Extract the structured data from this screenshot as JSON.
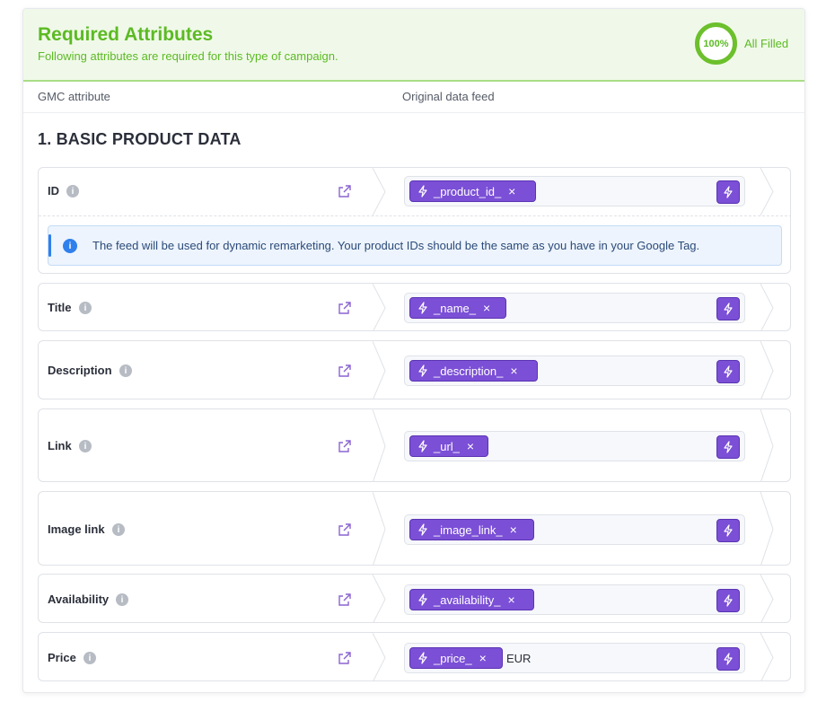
{
  "header": {
    "title": "Required Attributes",
    "subtitle": "Following attributes are required for this type of campaign.",
    "progress_value": "100%",
    "progress_label": "All Filled",
    "accent_color": "#5cba24"
  },
  "columns": {
    "gmc": "GMC attribute",
    "feed": "Original data feed"
  },
  "section": {
    "title": "1. BASIC PRODUCT DATA"
  },
  "notice": {
    "icon": "info-icon",
    "text": "The feed will be used for dynamic remarketing. Your product IDs should be the same as you have in your Google Tag."
  },
  "attributes": [
    {
      "name": "ID",
      "value": "_product_id_",
      "suffix": ""
    },
    {
      "name": "Title",
      "value": "_name_",
      "suffix": ""
    },
    {
      "name": "Description",
      "value": "_description_",
      "suffix": ""
    },
    {
      "name": "Link",
      "value": "_url_",
      "suffix": ""
    },
    {
      "name": "Image link",
      "value": "_image_link_",
      "suffix": ""
    },
    {
      "name": "Availability",
      "value": "_availability_",
      "suffix": ""
    },
    {
      "name": "Price",
      "value": "_price_",
      "suffix": "EUR"
    }
  ],
  "chip_remove_glyph": "×",
  "info_glyph": "i",
  "colors": {
    "chip": "#7b4fd6",
    "notice_accent": "#2f80ed"
  }
}
